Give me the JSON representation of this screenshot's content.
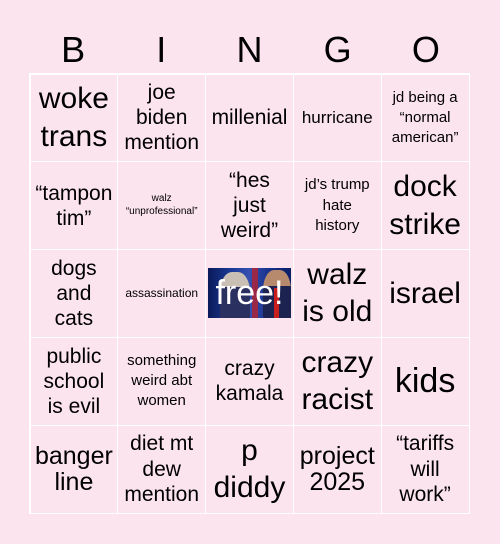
{
  "header": {
    "letters": [
      "B",
      "I",
      "N",
      "G",
      "O"
    ]
  },
  "grid": {
    "rows": [
      [
        {
          "lines": [
            "woke",
            "trans"
          ]
        },
        {
          "lines": [
            "joe",
            "biden",
            "mention"
          ]
        },
        {
          "lines": [
            "millenial"
          ]
        },
        {
          "lines": [
            "hurricane"
          ]
        },
        {
          "lines": [
            "jd being a",
            "“normal",
            "american”"
          ]
        }
      ],
      [
        {
          "lines": [
            "“tampon",
            "tim”"
          ]
        },
        {
          "lines": [
            "walz",
            "“unprofessional”"
          ]
        },
        {
          "lines": [
            "“hes",
            "just",
            "weird”"
          ]
        },
        {
          "lines": [
            "jd’s trump",
            "hate",
            "history"
          ]
        },
        {
          "lines": [
            "dock",
            "strike"
          ]
        }
      ],
      [
        {
          "lines": [
            "dogs",
            "and",
            "cats"
          ]
        },
        {
          "lines": [
            "assassination"
          ]
        },
        {
          "lines": [
            "free!"
          ],
          "free": true,
          "image": "walz-and-vance-photo"
        },
        {
          "lines": [
            "walz",
            "is old"
          ]
        },
        {
          "lines": [
            "israel"
          ]
        }
      ],
      [
        {
          "lines": [
            "public",
            "school",
            "is evil"
          ]
        },
        {
          "lines": [
            "something",
            "weird abt",
            "women"
          ]
        },
        {
          "lines": [
            "crazy",
            "kamala"
          ]
        },
        {
          "lines": [
            "crazy",
            "racist"
          ]
        },
        {
          "lines": [
            "kids"
          ]
        }
      ],
      [
        {
          "lines": [
            "banger",
            "line"
          ]
        },
        {
          "lines": [
            "diet mt",
            "dew",
            "mention"
          ]
        },
        {
          "lines": [
            "p",
            "diddy"
          ]
        },
        {
          "lines": [
            "project",
            "2025"
          ]
        },
        {
          "lines": [
            "“tariffs",
            "will",
            "work”"
          ]
        }
      ]
    ]
  },
  "colors": {
    "background": "#fce4ee",
    "grid_line": "#ffffff",
    "text": "#000000",
    "free_text": "#ffffff"
  }
}
